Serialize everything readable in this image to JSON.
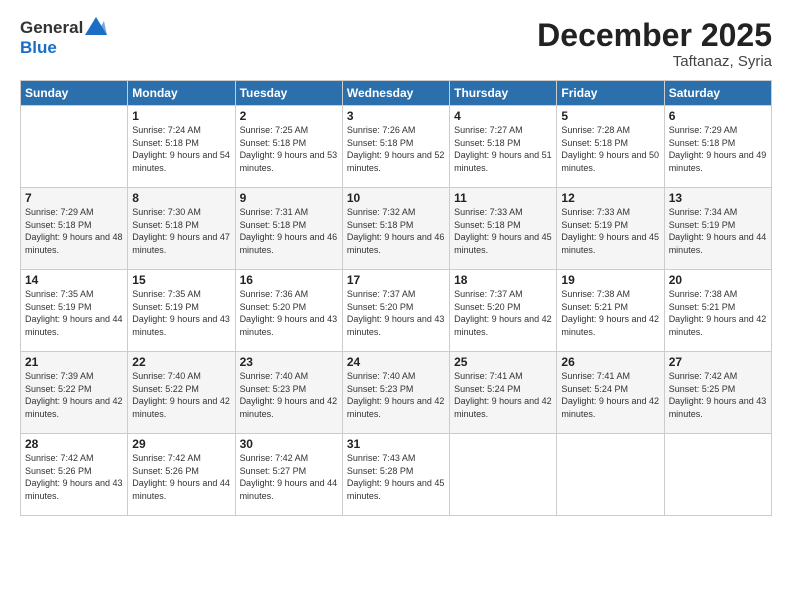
{
  "logo": {
    "general": "General",
    "blue": "Blue"
  },
  "title": {
    "month_year": "December 2025",
    "location": "Taftanaz, Syria"
  },
  "days_of_week": [
    "Sunday",
    "Monday",
    "Tuesday",
    "Wednesday",
    "Thursday",
    "Friday",
    "Saturday"
  ],
  "weeks": [
    [
      {
        "day": null,
        "sunrise": "",
        "sunset": "",
        "daylight": ""
      },
      {
        "day": "1",
        "sunrise": "Sunrise: 7:24 AM",
        "sunset": "Sunset: 5:18 PM",
        "daylight": "Daylight: 9 hours and 54 minutes."
      },
      {
        "day": "2",
        "sunrise": "Sunrise: 7:25 AM",
        "sunset": "Sunset: 5:18 PM",
        "daylight": "Daylight: 9 hours and 53 minutes."
      },
      {
        "day": "3",
        "sunrise": "Sunrise: 7:26 AM",
        "sunset": "Sunset: 5:18 PM",
        "daylight": "Daylight: 9 hours and 52 minutes."
      },
      {
        "day": "4",
        "sunrise": "Sunrise: 7:27 AM",
        "sunset": "Sunset: 5:18 PM",
        "daylight": "Daylight: 9 hours and 51 minutes."
      },
      {
        "day": "5",
        "sunrise": "Sunrise: 7:28 AM",
        "sunset": "Sunset: 5:18 PM",
        "daylight": "Daylight: 9 hours and 50 minutes."
      },
      {
        "day": "6",
        "sunrise": "Sunrise: 7:29 AM",
        "sunset": "Sunset: 5:18 PM",
        "daylight": "Daylight: 9 hours and 49 minutes."
      }
    ],
    [
      {
        "day": "7",
        "sunrise": "Sunrise: 7:29 AM",
        "sunset": "Sunset: 5:18 PM",
        "daylight": "Daylight: 9 hours and 48 minutes."
      },
      {
        "day": "8",
        "sunrise": "Sunrise: 7:30 AM",
        "sunset": "Sunset: 5:18 PM",
        "daylight": "Daylight: 9 hours and 47 minutes."
      },
      {
        "day": "9",
        "sunrise": "Sunrise: 7:31 AM",
        "sunset": "Sunset: 5:18 PM",
        "daylight": "Daylight: 9 hours and 46 minutes."
      },
      {
        "day": "10",
        "sunrise": "Sunrise: 7:32 AM",
        "sunset": "Sunset: 5:18 PM",
        "daylight": "Daylight: 9 hours and 46 minutes."
      },
      {
        "day": "11",
        "sunrise": "Sunrise: 7:33 AM",
        "sunset": "Sunset: 5:18 PM",
        "daylight": "Daylight: 9 hours and 45 minutes."
      },
      {
        "day": "12",
        "sunrise": "Sunrise: 7:33 AM",
        "sunset": "Sunset: 5:19 PM",
        "daylight": "Daylight: 9 hours and 45 minutes."
      },
      {
        "day": "13",
        "sunrise": "Sunrise: 7:34 AM",
        "sunset": "Sunset: 5:19 PM",
        "daylight": "Daylight: 9 hours and 44 minutes."
      }
    ],
    [
      {
        "day": "14",
        "sunrise": "Sunrise: 7:35 AM",
        "sunset": "Sunset: 5:19 PM",
        "daylight": "Daylight: 9 hours and 44 minutes."
      },
      {
        "day": "15",
        "sunrise": "Sunrise: 7:35 AM",
        "sunset": "Sunset: 5:19 PM",
        "daylight": "Daylight: 9 hours and 43 minutes."
      },
      {
        "day": "16",
        "sunrise": "Sunrise: 7:36 AM",
        "sunset": "Sunset: 5:20 PM",
        "daylight": "Daylight: 9 hours and 43 minutes."
      },
      {
        "day": "17",
        "sunrise": "Sunrise: 7:37 AM",
        "sunset": "Sunset: 5:20 PM",
        "daylight": "Daylight: 9 hours and 43 minutes."
      },
      {
        "day": "18",
        "sunrise": "Sunrise: 7:37 AM",
        "sunset": "Sunset: 5:20 PM",
        "daylight": "Daylight: 9 hours and 42 minutes."
      },
      {
        "day": "19",
        "sunrise": "Sunrise: 7:38 AM",
        "sunset": "Sunset: 5:21 PM",
        "daylight": "Daylight: 9 hours and 42 minutes."
      },
      {
        "day": "20",
        "sunrise": "Sunrise: 7:38 AM",
        "sunset": "Sunset: 5:21 PM",
        "daylight": "Daylight: 9 hours and 42 minutes."
      }
    ],
    [
      {
        "day": "21",
        "sunrise": "Sunrise: 7:39 AM",
        "sunset": "Sunset: 5:22 PM",
        "daylight": "Daylight: 9 hours and 42 minutes."
      },
      {
        "day": "22",
        "sunrise": "Sunrise: 7:40 AM",
        "sunset": "Sunset: 5:22 PM",
        "daylight": "Daylight: 9 hours and 42 minutes."
      },
      {
        "day": "23",
        "sunrise": "Sunrise: 7:40 AM",
        "sunset": "Sunset: 5:23 PM",
        "daylight": "Daylight: 9 hours and 42 minutes."
      },
      {
        "day": "24",
        "sunrise": "Sunrise: 7:40 AM",
        "sunset": "Sunset: 5:23 PM",
        "daylight": "Daylight: 9 hours and 42 minutes."
      },
      {
        "day": "25",
        "sunrise": "Sunrise: 7:41 AM",
        "sunset": "Sunset: 5:24 PM",
        "daylight": "Daylight: 9 hours and 42 minutes."
      },
      {
        "day": "26",
        "sunrise": "Sunrise: 7:41 AM",
        "sunset": "Sunset: 5:24 PM",
        "daylight": "Daylight: 9 hours and 42 minutes."
      },
      {
        "day": "27",
        "sunrise": "Sunrise: 7:42 AM",
        "sunset": "Sunset: 5:25 PM",
        "daylight": "Daylight: 9 hours and 43 minutes."
      }
    ],
    [
      {
        "day": "28",
        "sunrise": "Sunrise: 7:42 AM",
        "sunset": "Sunset: 5:26 PM",
        "daylight": "Daylight: 9 hours and 43 minutes."
      },
      {
        "day": "29",
        "sunrise": "Sunrise: 7:42 AM",
        "sunset": "Sunset: 5:26 PM",
        "daylight": "Daylight: 9 hours and 44 minutes."
      },
      {
        "day": "30",
        "sunrise": "Sunrise: 7:42 AM",
        "sunset": "Sunset: 5:27 PM",
        "daylight": "Daylight: 9 hours and 44 minutes."
      },
      {
        "day": "31",
        "sunrise": "Sunrise: 7:43 AM",
        "sunset": "Sunset: 5:28 PM",
        "daylight": "Daylight: 9 hours and 45 minutes."
      },
      {
        "day": null,
        "sunrise": "",
        "sunset": "",
        "daylight": ""
      },
      {
        "day": null,
        "sunrise": "",
        "sunset": "",
        "daylight": ""
      },
      {
        "day": null,
        "sunrise": "",
        "sunset": "",
        "daylight": ""
      }
    ]
  ]
}
